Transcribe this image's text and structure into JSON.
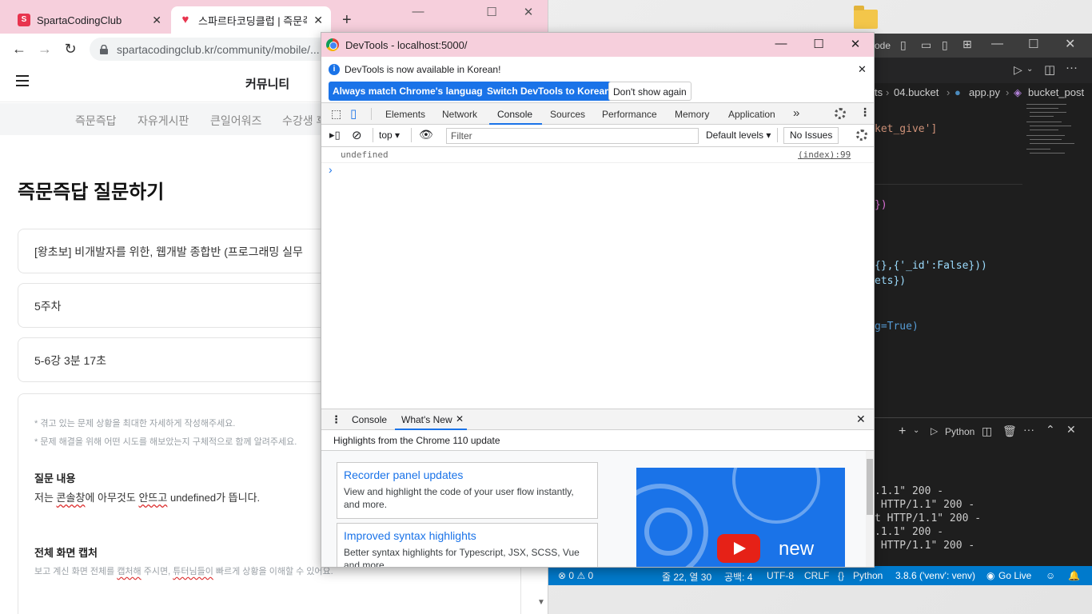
{
  "chrome": {
    "tabs": [
      {
        "title": "SpartaCodingClub",
        "favicon": "sparta-icon"
      },
      {
        "title": "스파르타코딩클럽 | 즉문즉",
        "favicon": "sparta-heart-icon"
      }
    ],
    "url": "spartacodingclub.kr/community/mobile/..."
  },
  "page": {
    "header_title": "커뮤니티",
    "categories": [
      "즉문즉답",
      "자유게시판",
      "큰일어워즈",
      "수강생 후"
    ],
    "question_title": "즉문즉답 질문하기",
    "course": "[왕초보] 비개발자를 위한, 웹개발 종합반 (프로그래밍 실무",
    "week": "5주차",
    "lecture": "5-6강 3분 17초",
    "hint1": "* 겪고 있는 문제 상황을 최대한 자세하게 작성해주세요.",
    "hint2": "* 문제 해결을 위해 어떤 시도를 해보았는지 구체적으로 함께 알려주세요.",
    "content_label": "질문 내용",
    "content_pre": "저는 ",
    "content_w1": "콘솔창",
    "content_mid1": "에 아무것도 ",
    "content_w2": "안뜨고",
    "content_post": " undefined가 뜹니다.",
    "capture_label": "전체 화면 캡처",
    "capture_pre": "보고 계신 화면 전체를 ",
    "capture_w1": "캡처해",
    "capture_mid": " 주시면, ",
    "capture_w2": "튜터님들이",
    "capture_post": " 빠르게 상황을 이해할 수 있어요."
  },
  "vscode": {
    "title_suffix": "ode",
    "breadcrumb": [
      "ts",
      "04.bucket",
      "app.py",
      "bucket_post"
    ],
    "code_lines": [
      {
        "text": "ket_give']",
        "color": "#ce9178"
      },
      {
        "text": "})",
        "color": "#da70d6"
      },
      {
        "text": "{},{'_id':False}))",
        "color": "#9cdcfe"
      },
      {
        "text": "ets})",
        "color": "#9cdcfe"
      },
      {
        "text": "g=True)",
        "color": "#569cd6"
      }
    ],
    "terminal_label": "Python",
    "terminal_lines": [
      ".1.1\" 200 -",
      " HTTP/1.1\" 200 -",
      "t HTTP/1.1\" 200 -",
      ".1.1\" 200 -",
      " HTTP/1.1\" 200 -"
    ],
    "status": {
      "errors": "0",
      "warnings": "0",
      "position": "줄 22, 열 30",
      "spaces": "공백: 4",
      "encoding": "UTF-8",
      "eol": "CRLF",
      "language": "Python",
      "interpreter": "3.8.6 ('venv': venv)",
      "golive": "Go Live"
    }
  },
  "devtools": {
    "window_title": "DevTools - localhost:5000/",
    "info_text": "DevTools is now available in Korean!",
    "btn_match": "Always match Chrome's language",
    "btn_switch": "Switch DevTools to Korean",
    "btn_dont": "Don't show again",
    "tabs": [
      "Elements",
      "Network",
      "Console",
      "Sources",
      "Performance",
      "Memory",
      "Application"
    ],
    "active_tab": "Console",
    "context": "top",
    "filter_placeholder": "Filter",
    "levels": "Default levels",
    "issues": "No Issues",
    "log_value": "undefined",
    "log_source": "(index):99",
    "prompt": "›",
    "drawer_tabs": [
      "Console",
      "What's New"
    ],
    "whats_new_heading": "Highlights from the Chrome 110 update",
    "cards": [
      {
        "title": "Recorder panel updates",
        "desc": "View and highlight the code of your user flow instantly, and more."
      },
      {
        "title": "Improved syntax highlights",
        "desc": "Better syntax highlights for Typescript, JSX, SCSS, Vue and more."
      }
    ],
    "video_text": "new"
  }
}
